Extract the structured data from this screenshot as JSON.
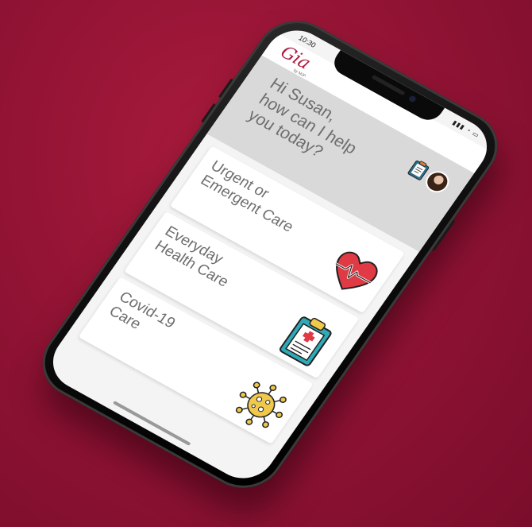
{
  "status_bar": {
    "time": "10:30",
    "signal_icons": "▮▮▮ ◔ ▭"
  },
  "header": {
    "logo_text": "Gia",
    "logo_sub": "by MJP"
  },
  "greeting": {
    "text": "Hi Susan,\nhow can I help\nyou today?",
    "clipboard_icon": "clipboard-icon",
    "avatar_icon": "user-avatar"
  },
  "cards": [
    {
      "label": "Urgent or\nEmergent Care",
      "icon": "heart-pulse-icon"
    },
    {
      "label": "Everyday\nHealth Care",
      "icon": "medical-clipboard-icon"
    },
    {
      "label": "Covid-19\nCare",
      "icon": "virus-icon"
    }
  ],
  "colors": {
    "background": "#8e1233",
    "brand": "#b0173c",
    "heart": "#e03a45",
    "clipboard": "#2eaab8",
    "virus": "#f0c84a"
  }
}
